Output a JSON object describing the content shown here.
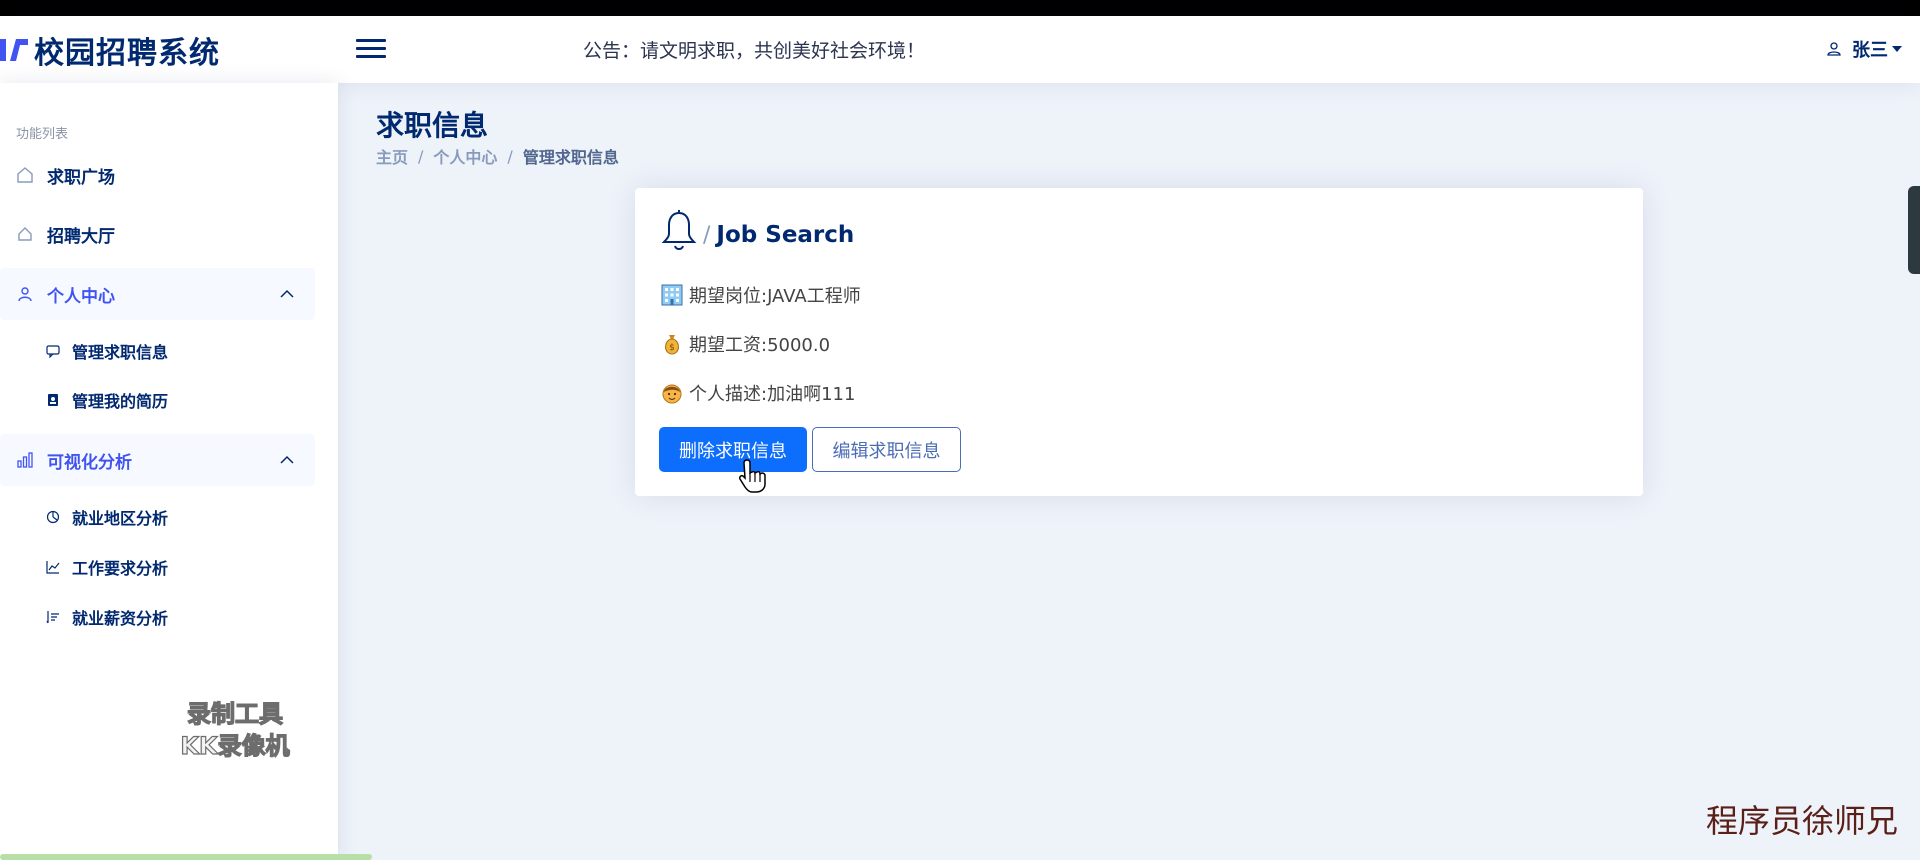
{
  "app": {
    "title": "校园招聘系统",
    "notice": "公告：请文明求职，共创美好社会环境！"
  },
  "user": {
    "name": "张三"
  },
  "sidebar": {
    "heading": "功能列表",
    "items": [
      {
        "label": "求职广场",
        "icon": "home-icon"
      },
      {
        "label": "招聘大厅",
        "icon": "house-icon"
      },
      {
        "label": "个人中心",
        "icon": "person-icon",
        "expanded": true,
        "children": [
          {
            "label": "管理求职信息",
            "icon": "message-icon"
          },
          {
            "label": "管理我的简历",
            "icon": "resume-icon"
          }
        ]
      },
      {
        "label": "可视化分析",
        "icon": "bar-chart-icon",
        "expanded": true,
        "children": [
          {
            "label": "就业地区分析",
            "icon": "pie-icon"
          },
          {
            "label": "工作要求分析",
            "icon": "line-chart-icon"
          },
          {
            "label": "就业薪资分析",
            "icon": "sort-icon"
          }
        ]
      }
    ]
  },
  "main": {
    "title": "求职信息",
    "breadcrumb": [
      "主页",
      "个人中心",
      "管理求职信息"
    ],
    "card": {
      "slash": "/",
      "title": "Job Search",
      "position": "期望岗位:JAVA工程师",
      "salary": "期望工资:5000.0",
      "description": "个人描述:加油啊111",
      "delete_label": "删除求职信息",
      "edit_label": "编辑求职信息"
    }
  },
  "watermarks": {
    "recorder_line1": "录制工具",
    "recorder_line2": "KK录像机",
    "author": "程序员徐师兄"
  },
  "colors": {
    "primary": "#0d6efd",
    "navy": "#012970",
    "accent": "#4154f1",
    "background": "#eef2f9"
  }
}
